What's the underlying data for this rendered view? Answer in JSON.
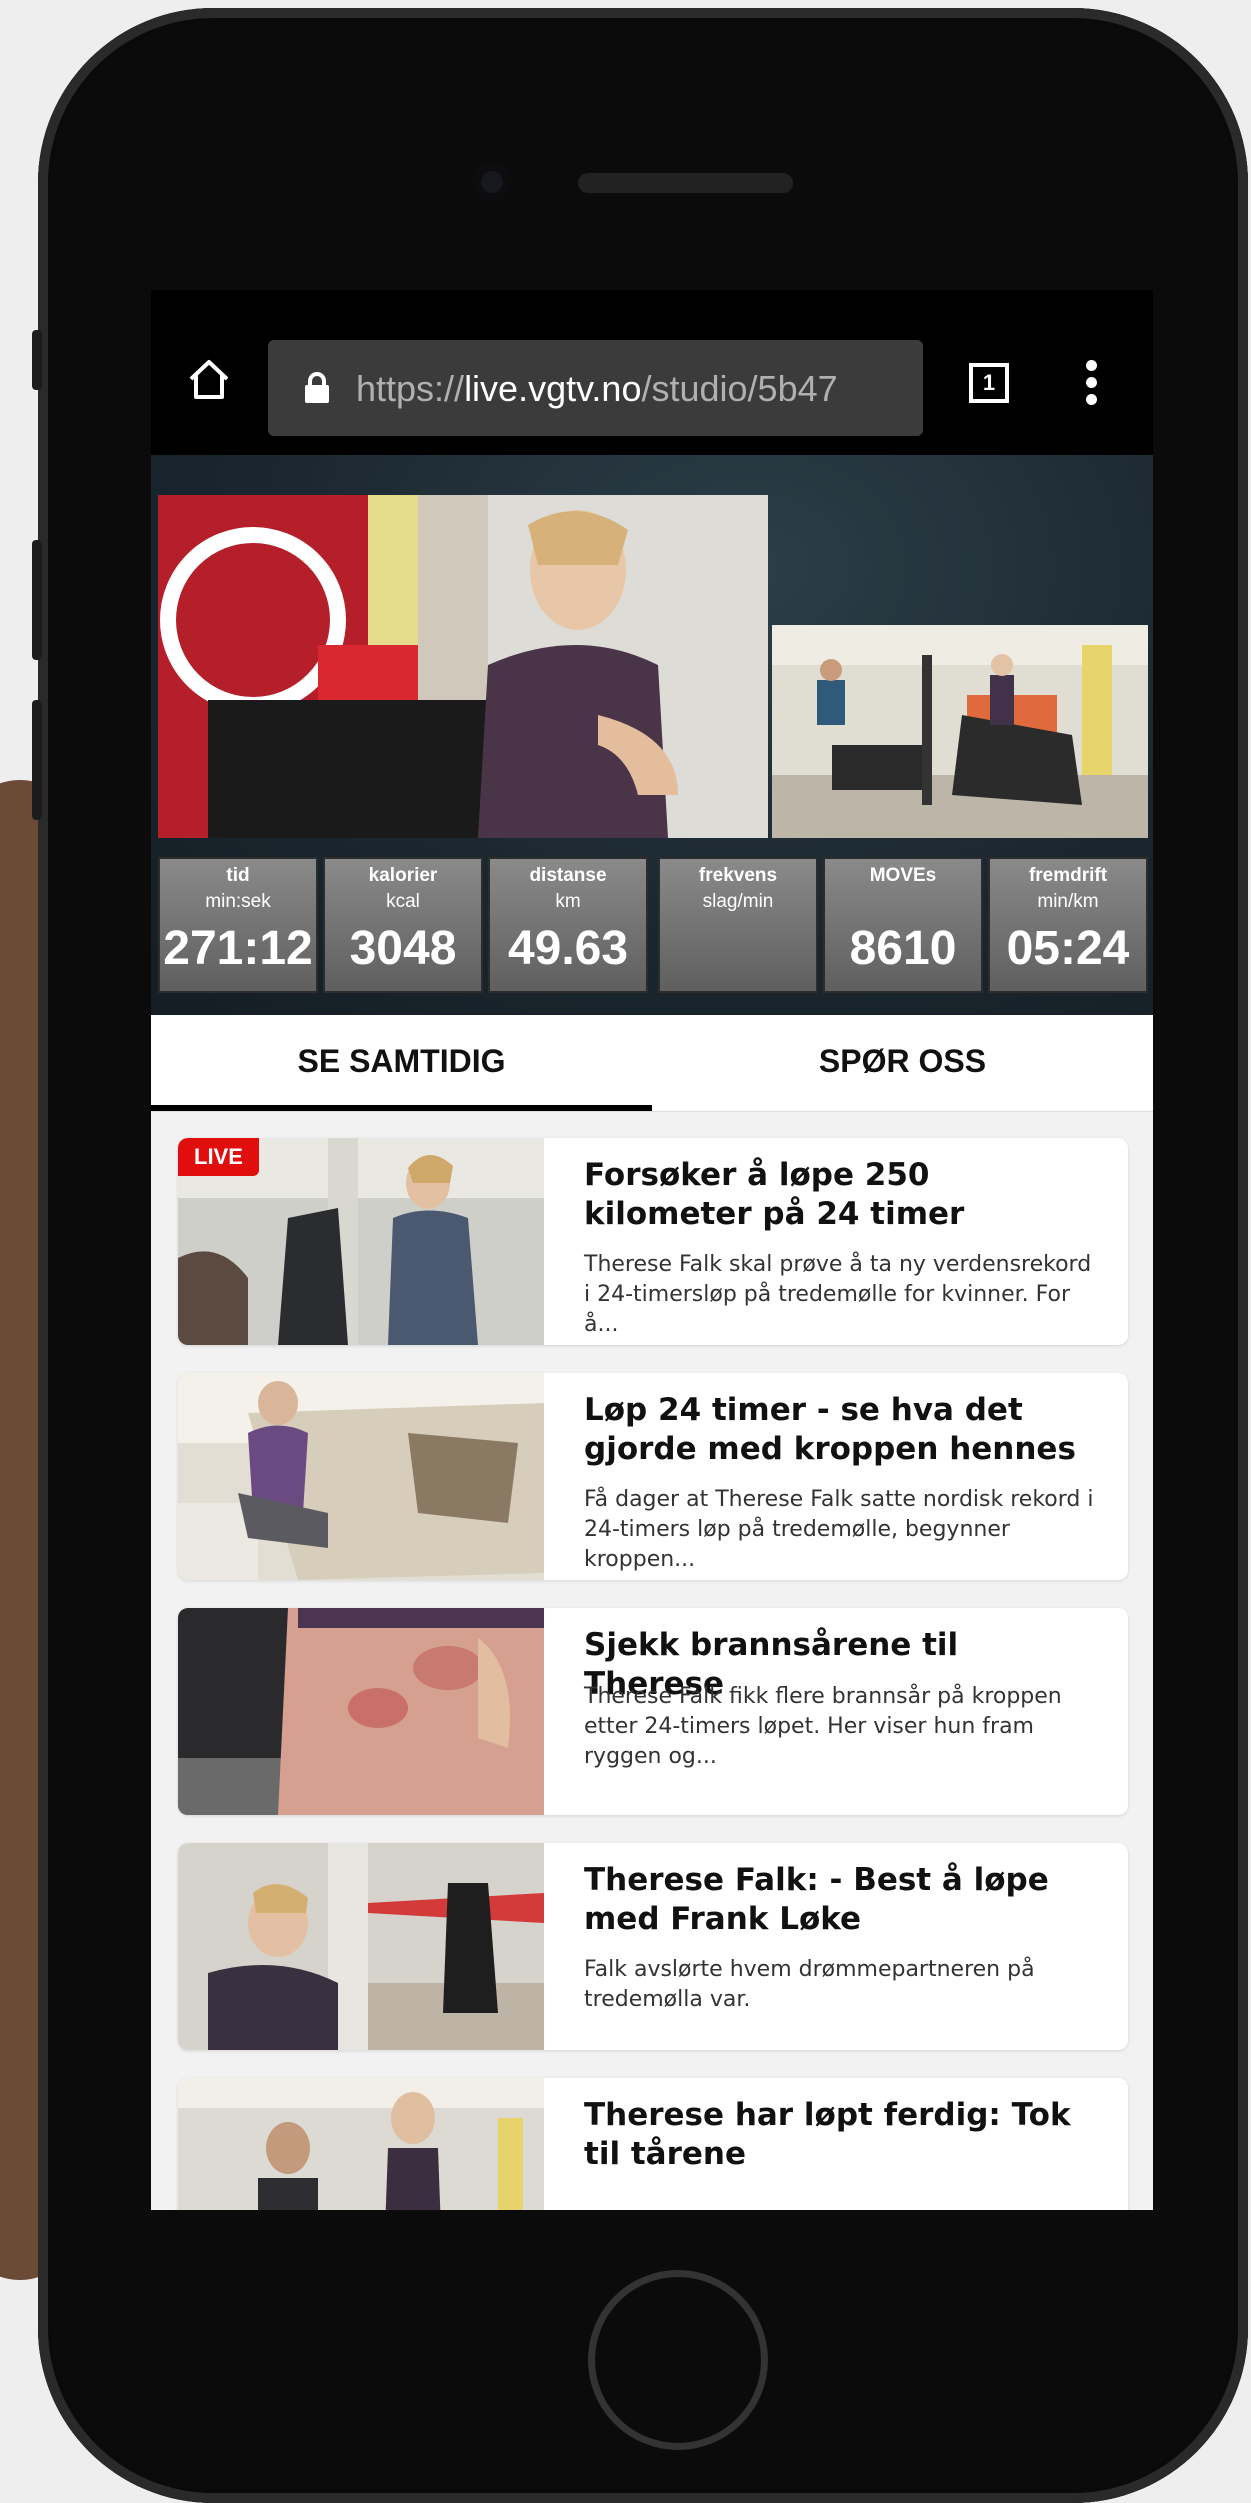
{
  "browser": {
    "url_scheme": "https://",
    "url_host": "live.vgtv.no",
    "url_path": "/studio/5b47",
    "tab_count": "1"
  },
  "player": {
    "stats": [
      {
        "label": "tid",
        "unit": "min:sek",
        "value": "271:12"
      },
      {
        "label": "kalorier",
        "unit": "kcal",
        "value": "3048"
      },
      {
        "label": "distanse",
        "unit": "km",
        "value": "49.63"
      },
      {
        "label": "frekvens",
        "unit": "slag/min",
        "value": ""
      },
      {
        "label": "MOVEs",
        "unit": "",
        "value": "8610"
      },
      {
        "label": "fremdrift",
        "unit": "min/km",
        "value": "05:24"
      }
    ]
  },
  "tabs": {
    "left": "SE SAMTIDIG",
    "right": "SPØR OSS"
  },
  "feed": {
    "live_badge": "LIVE",
    "items": [
      {
        "title": "Forsøker å løpe 250 kilometer på 24 timer",
        "desc": "Therese Falk skal prøve å ta ny verdensrekord i 24-timersløp på tredemølle for kvinner. For å..."
      },
      {
        "title": "Løp 24 timer - se hva det gjorde med kroppen hennes",
        "desc": "Få dager at Therese Falk satte nordisk rekord i 24-timers løp på tredemølle, begynner kroppen..."
      },
      {
        "title": "Sjekk brannsårene til Therese",
        "desc": "Therese Falk fikk flere brannsår på kroppen etter 24-timers løpet. Her viser hun fram ryggen og..."
      },
      {
        "title": "Therese Falk: - Best å løpe med Frank Løke",
        "desc": "Falk avslørte hvem drømmepartneren på tredemølla var."
      },
      {
        "title": "Therese har løpt ferdig: Tok til tårene",
        "desc": ""
      }
    ]
  }
}
